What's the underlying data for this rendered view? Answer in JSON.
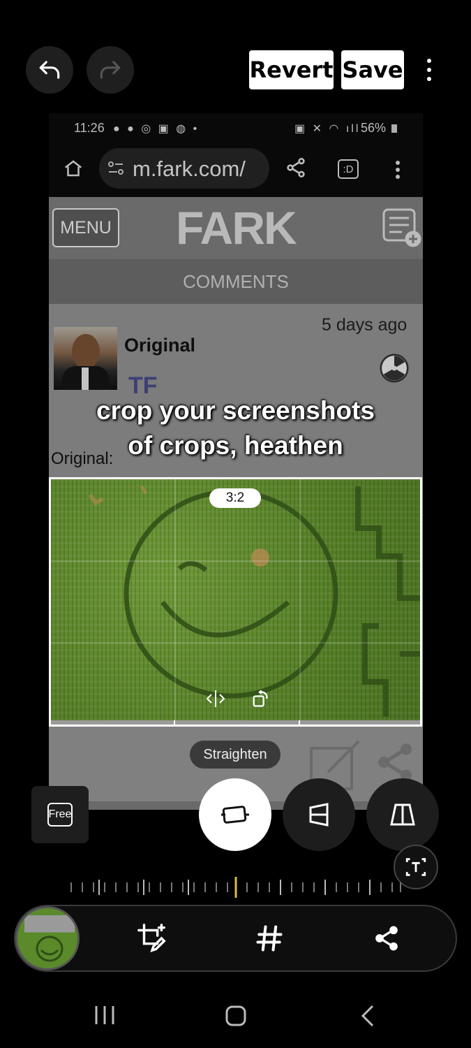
{
  "editor": {
    "revert_label": "Revert",
    "save_label": "Save",
    "undo_icon": "undo-icon",
    "redo_icon": "redo-icon",
    "more_icon": "more-vertical-icon"
  },
  "screenshot": {
    "status": {
      "time": "11:26",
      "battery": "56%"
    },
    "browser": {
      "url": "m.fark.com/",
      "tab_badge": ":D"
    },
    "site": {
      "menu_label": "MENU",
      "logo": "FARK",
      "comments_label": "COMMENTS"
    },
    "comment": {
      "time_ago": "5 days ago",
      "username": "Original",
      "tf_badge": "TF",
      "body_prefix": "Original:"
    }
  },
  "caption": {
    "line1": "crop your screenshots",
    "line2": "of crops, heathen"
  },
  "crop": {
    "ratio_label": "3:2",
    "straighten_label": "Straighten"
  },
  "tools": {
    "free_label": "Free"
  },
  "ruler": {
    "level": 0.5
  },
  "colors": {
    "accent": "#e0b84a",
    "field": "#5a8a2a"
  }
}
